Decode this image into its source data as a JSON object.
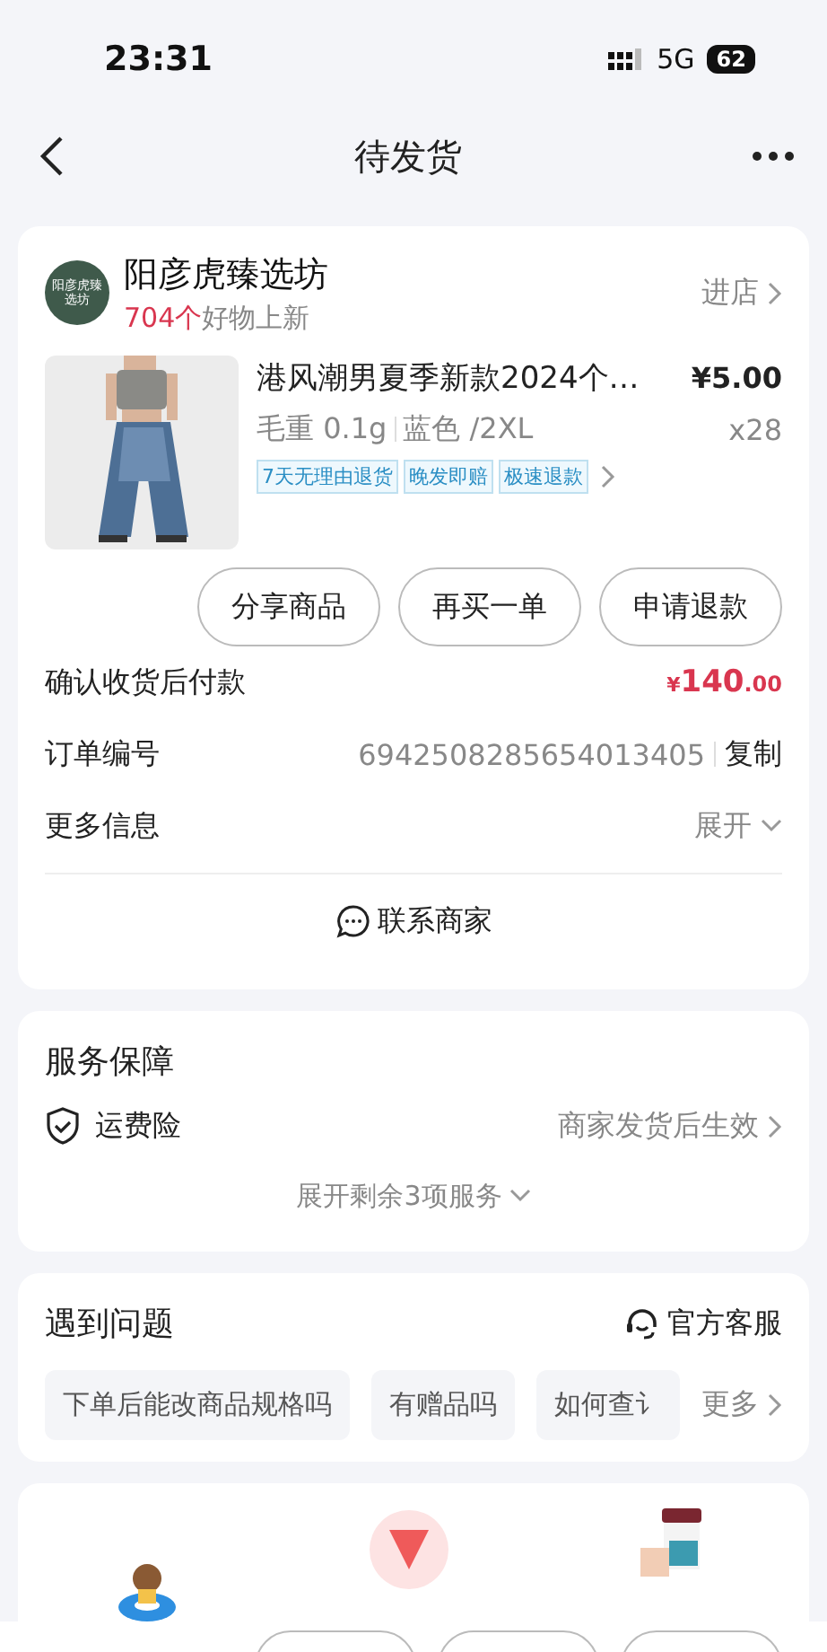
{
  "status_bar": {
    "time": "23:31",
    "network": "5G",
    "battery": "62"
  },
  "nav": {
    "title": "待发货"
  },
  "order": {
    "shop": {
      "avatar_text": "阳彦虎臻选坊",
      "name": "阳彦虎臻选坊",
      "new_count": "704个",
      "new_label": "好物上新",
      "enter": "进店"
    },
    "product": {
      "title": "港风潮男夏季新款2024个…",
      "price": "¥5.00",
      "weight": "毛重 0.1g",
      "spec": "蓝色 /2XL",
      "qty": "x28",
      "tags": [
        "7天无理由退货",
        "晚发即赔",
        "极速退款"
      ]
    },
    "actions": [
      "分享商品",
      "再买一单",
      "申请退款"
    ],
    "pay": {
      "label": "确认收货后付款",
      "currency": "¥",
      "amount": "140",
      "cents": ".00"
    },
    "order_no": {
      "label": "订单编号",
      "value": "6942508285654013405",
      "copy": "复制"
    },
    "more": {
      "label": "更多信息",
      "toggle": "展开"
    },
    "contact": "联系商家"
  },
  "service": {
    "title": "服务保障",
    "item": {
      "name": "运费险",
      "status": "商家发货后生效"
    },
    "expand": "展开剩余3项服务"
  },
  "problems": {
    "title": "遇到问题",
    "support": "官方客服",
    "chips": [
      "下单后能改商品规格吗",
      "有赠品吗",
      "如何查讠"
    ],
    "more": "更多"
  }
}
